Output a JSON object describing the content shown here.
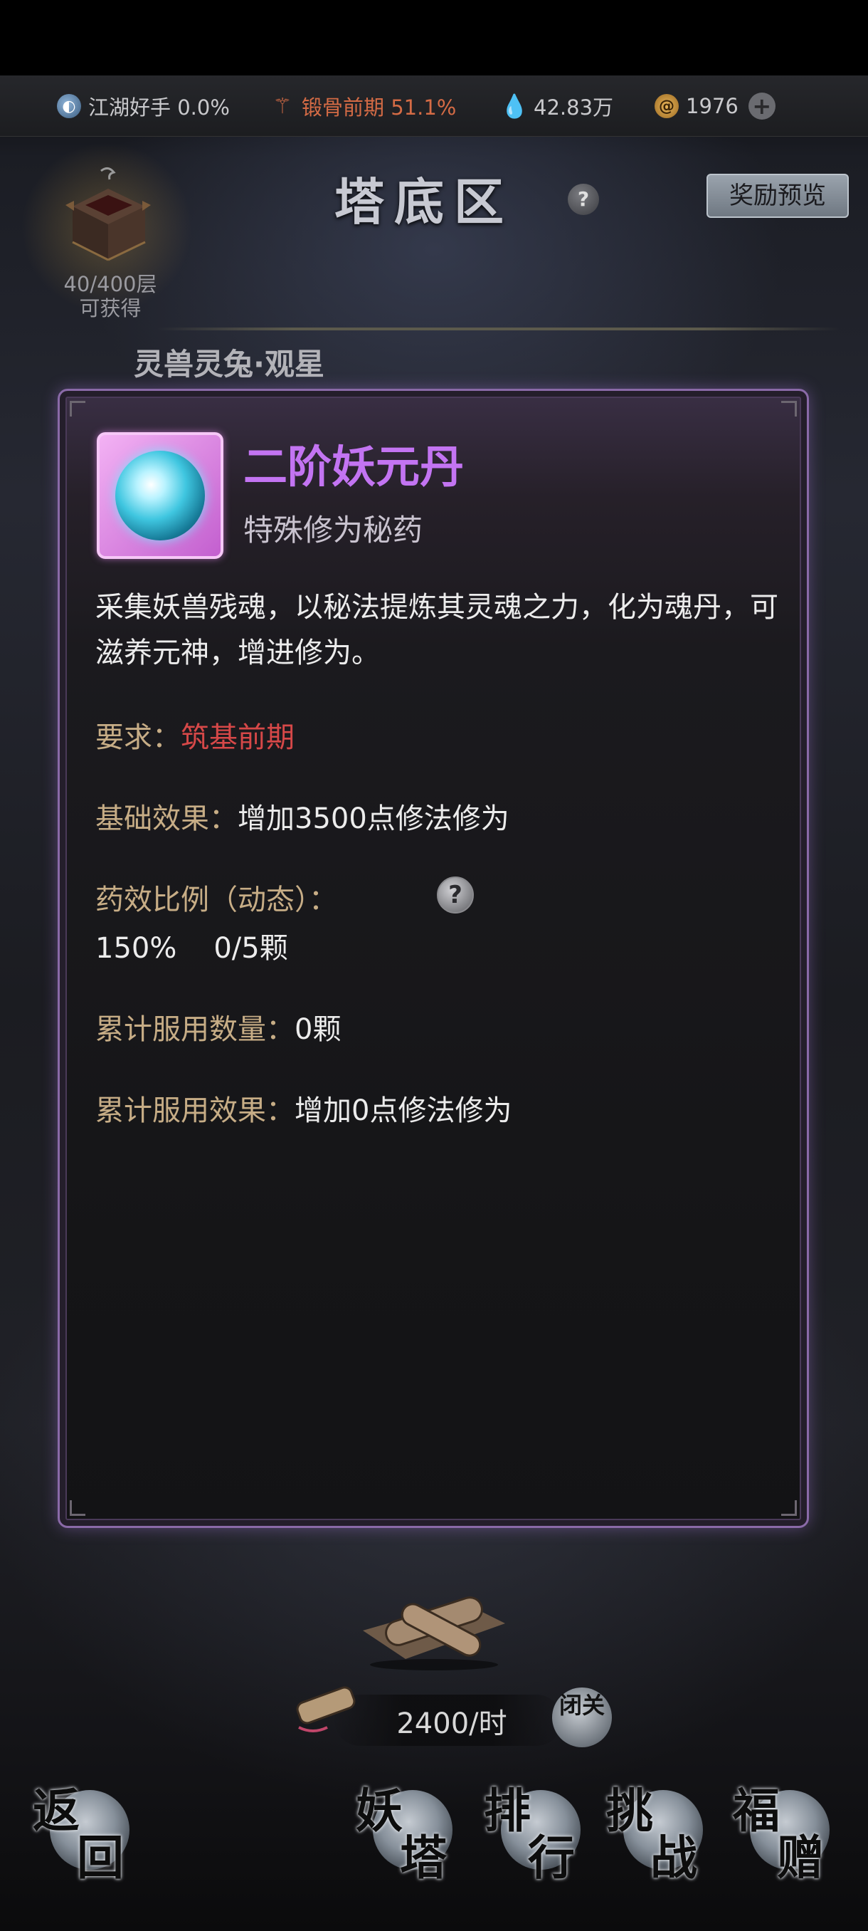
{
  "status_bar": {
    "realm": {
      "label": "江湖好手 0.0%",
      "icon": "realm-orb-icon"
    },
    "bone": {
      "label": "锻骨前期 51.1%",
      "icon": "bone-stage-icon",
      "color": "#d46b45"
    },
    "crystal": {
      "label": "42.83万",
      "icon": "crystal-icon"
    },
    "coin": {
      "label": "1976",
      "icon": "coin-icon"
    },
    "plus": "+"
  },
  "tower": {
    "count_line1": "40/400层",
    "count_line2": "可获得",
    "zone_title": "塔底区",
    "help": "?",
    "reward_button": "奖励预览",
    "spirit_beast": "灵兽灵兔·观星"
  },
  "item_panel": {
    "name": "二阶妖元丹",
    "type": "特殊修为秘药",
    "description": "采集妖兽残魂，以秘法提炼其灵魂之力，化为魂丹，可滋养元神，增进修为。",
    "requirement_label": "要求：",
    "requirement_value": "筑基前期",
    "base_effect_label": "基础效果：",
    "base_effect_value": "增加3500点修法修为",
    "ratio_label": "药效比例（动态）：",
    "ratio_help": "?",
    "ratio_value": "150%",
    "ratio_count": "0/5颗",
    "taken_label": "累计服用数量：",
    "taken_value": "0颗",
    "cum_effect_label": "累计服用效果：",
    "cum_effect_value": "增加0点修法修为",
    "colors": {
      "name": "#c374f2",
      "requirement": "#d64848",
      "label": "#c7ad86"
    }
  },
  "bottom": {
    "rate": "2400/时",
    "seclusion": "闭关",
    "nav": {
      "back": [
        "返",
        "回"
      ],
      "tower": [
        "妖",
        "塔"
      ],
      "rank": [
        "排",
        "行"
      ],
      "challenge": [
        "挑",
        "战"
      ],
      "gift": [
        "福",
        "赠"
      ]
    }
  }
}
